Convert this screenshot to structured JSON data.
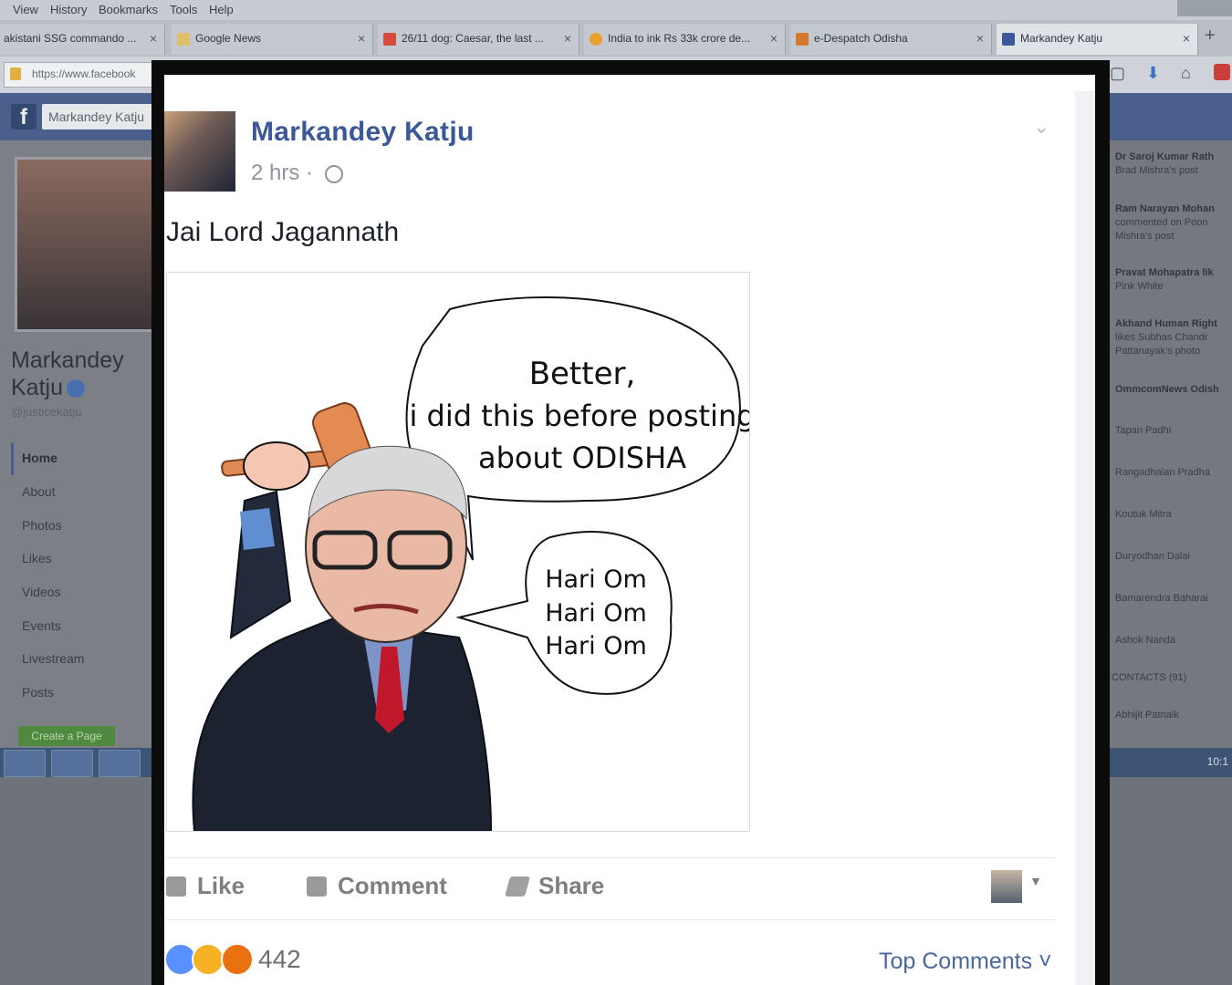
{
  "browser": {
    "menu": [
      "View",
      "History",
      "Bookmarks",
      "Tools",
      "Help"
    ],
    "tabs": [
      {
        "title": "akistani SSG commando ...",
        "color": "#bfc3c9"
      },
      {
        "title": "Google News",
        "color": "#e0bf6a"
      },
      {
        "title": "26/11 dog: Caesar, the last ...",
        "color": "#d64b3b"
      },
      {
        "title": "India to ink Rs 33k crore de...",
        "color": "#e8a030"
      },
      {
        "title": "e-Despatch Odisha",
        "color": "#d07a30"
      },
      {
        "title": "Markandey Katju",
        "color": "#3b5998"
      }
    ],
    "new_tab": "+",
    "url": "https://www.facebook"
  },
  "fb": {
    "logo": "f",
    "search_value": "Markandey Katju"
  },
  "page": {
    "name_line1": "Markandey",
    "name_line2": "Katju",
    "handle": "@justicekatju",
    "nav": [
      "Home",
      "About",
      "Photos",
      "Likes",
      "Videos",
      "Events",
      "Livestream",
      "Posts"
    ],
    "create_page": "Create a Page"
  },
  "sidebar": {
    "friends": [
      {
        "line1": "Dr Saroj Kumar Rath",
        "line2": "Brad Mishra's post"
      },
      {
        "line1": "Ram Narayan Mohan",
        "line2": "commented on Poon",
        "line3": "Mishra's post"
      },
      {
        "line1": "Pravat Mohapatra lik",
        "line2": "Pink White"
      },
      {
        "line1": "Akhand Human Right",
        "line2": "likes Subhas Chandr",
        "line3": "Pattanayak's photo"
      },
      {
        "line1": "OmmcomNews Odish"
      },
      {
        "line1": "Tapan Padhi"
      },
      {
        "line1": "Rangadhalan Pradha"
      },
      {
        "line1": "Koutuk Mitra"
      },
      {
        "line1": "Duryodhan Dalai"
      },
      {
        "line1": "Bamarendra Baharai"
      },
      {
        "line1": "Ashok Nanda"
      },
      {
        "line1": "CONTACTS (91)"
      },
      {
        "line1": "Abhijit Patnaik"
      }
    ],
    "clock": "10:1"
  },
  "post": {
    "author": "Markandey Katju",
    "time": "2 hrs · ",
    "text": "Jai Lord Jagannath",
    "cartoon": {
      "bubble1": [
        "Better,",
        "i did this before posting",
        "about ODISHA"
      ],
      "bubble2": [
        "Hari Om",
        "Hari Om",
        "Hari Om"
      ]
    },
    "actions": {
      "like": "Like",
      "comment": "Comment",
      "share": "Share"
    },
    "reactions": {
      "count": "442",
      "colors": [
        "#5890ff",
        "#f7b125",
        "#e9710f"
      ]
    },
    "top_comments": "Top Comments ˅"
  }
}
